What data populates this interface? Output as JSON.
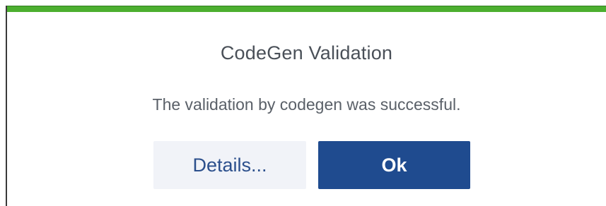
{
  "dialog": {
    "title": "CodeGen Validation",
    "message": "The validation by codegen was successful.",
    "status_color": "#4caf2f",
    "buttons": {
      "details_label": "Details...",
      "ok_label": "Ok"
    }
  }
}
